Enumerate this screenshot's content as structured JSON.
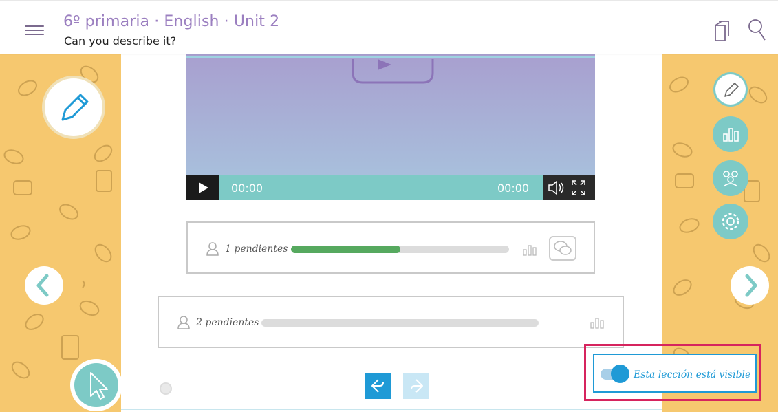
{
  "header": {
    "course_title": "6º primaria · English · Unit 2",
    "lesson_title": "Can you describe it?"
  },
  "video": {
    "current_time": "00:00",
    "duration": "00:00"
  },
  "activities": [
    {
      "pending_label": "1 pendientes",
      "progress": 0.5
    },
    {
      "pending_label": "2 pendientes",
      "progress": 0.0
    }
  ],
  "visibility": {
    "label": "Esta lección está visible",
    "enabled": true
  },
  "colors": {
    "accent_purple": "#9b7fc0",
    "teal": "#7dcac6",
    "blue": "#1f9ad6",
    "pattern_yellow": "#f6c86f",
    "highlight_red": "#d6245e",
    "progress_green": "#56a95f"
  },
  "icons": {
    "menu": "hamburger-icon",
    "copy": "copy-icon",
    "search": "search-icon",
    "edit": "pencil-icon",
    "stats": "bar-chart-icon",
    "groups": "group-icon",
    "settings": "gear-icon",
    "prev": "chevron-left-icon",
    "next": "chevron-right-icon",
    "cursor": "cursor-icon",
    "undo": "undo-icon",
    "redo": "redo-icon"
  }
}
